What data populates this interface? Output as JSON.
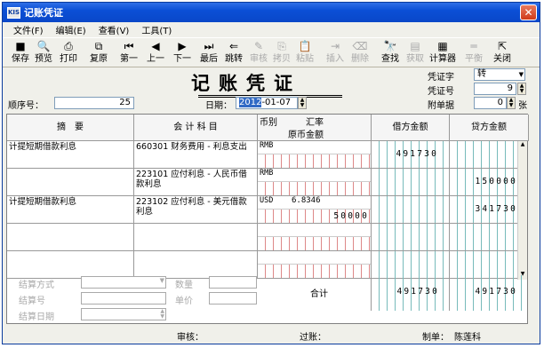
{
  "window": {
    "title": "记账凭证",
    "app_icon": "KIS"
  },
  "menu": [
    "文件(F)",
    "编辑(E)",
    "查看(V)",
    "工具(T)"
  ],
  "toolbar": [
    {
      "label": "保存",
      "icon": "save-icon",
      "glyph": "■",
      "enabled": true
    },
    {
      "label": "预览",
      "icon": "preview-icon",
      "glyph": "🔍",
      "enabled": true
    },
    {
      "label": "打印",
      "icon": "print-icon",
      "glyph": "⎙",
      "enabled": true
    },
    {
      "label": "复原",
      "icon": "restore-icon",
      "glyph": "⧉",
      "enabled": true
    },
    {
      "label": "第一",
      "icon": "first-icon",
      "glyph": "⏮",
      "enabled": true
    },
    {
      "label": "上一",
      "icon": "prev-icon",
      "glyph": "◀",
      "enabled": true
    },
    {
      "label": "下一",
      "icon": "next-icon",
      "glyph": "▶",
      "enabled": true
    },
    {
      "label": "最后",
      "icon": "last-icon",
      "glyph": "⏭",
      "enabled": true
    },
    {
      "label": "跳转",
      "icon": "jump-icon",
      "glyph": "⇐",
      "enabled": true
    },
    {
      "label": "审核",
      "icon": "audit-icon",
      "glyph": "✎",
      "enabled": false
    },
    {
      "label": "拷贝",
      "icon": "copy-icon",
      "glyph": "⎘",
      "enabled": false
    },
    {
      "label": "粘贴",
      "icon": "paste-icon",
      "glyph": "📋",
      "enabled": false
    },
    {
      "label": "插入",
      "icon": "insert-icon",
      "glyph": "⇥",
      "enabled": false
    },
    {
      "label": "删除",
      "icon": "delete-icon",
      "glyph": "⌫",
      "enabled": false
    },
    {
      "label": "查找",
      "icon": "find-icon",
      "glyph": "🔭",
      "enabled": true
    },
    {
      "label": "获取",
      "icon": "fetch-icon",
      "glyph": "▤",
      "enabled": false
    },
    {
      "label": "计算器",
      "icon": "calculator-icon",
      "glyph": "▦",
      "enabled": true
    },
    {
      "label": "平衡",
      "icon": "balance-icon",
      "glyph": "═",
      "enabled": false
    },
    {
      "label": "关闭",
      "icon": "exit-icon",
      "glyph": "⇱",
      "enabled": true
    }
  ],
  "header": {
    "title": "记账凭证",
    "voucher_word_label": "凭证字",
    "voucher_word": "转",
    "voucher_no_label": "凭证号",
    "voucher_no": "9",
    "attachments_label": "附单据",
    "attachments": "0",
    "attachments_unit": "张",
    "seq_label": "顺序号：",
    "seq": "25",
    "date_label": "日期：",
    "date_year": "2012",
    "date_rest": "-01-07"
  },
  "columns": {
    "summary": "摘　要",
    "account": "会 计 科 目",
    "currency": "币别",
    "rate": "汇率",
    "orig": "原币金额",
    "debit": "借方金额",
    "credit": "贷方金额"
  },
  "rows": [
    {
      "summary": "计提短期借款利息",
      "account": "660301 财务费用 - 利息支出",
      "currency": "RMB",
      "rate": "",
      "orig": "",
      "debit": "491730",
      "credit": ""
    },
    {
      "summary": "",
      "account": "223101 应付利息 - 人民币借款利息",
      "currency": "RMB",
      "rate": "",
      "orig": "",
      "debit": "",
      "credit": "150000"
    },
    {
      "summary": "计提短期借款利息",
      "account": "223102 应付利息 - 美元借款利息",
      "currency": "USD",
      "rate": "6.8346",
      "orig": "50000",
      "debit": "",
      "credit": "341730"
    },
    {
      "summary": "",
      "account": "",
      "currency": "",
      "rate": "",
      "orig": "",
      "debit": "",
      "credit": ""
    },
    {
      "summary": "",
      "account": "",
      "currency": "",
      "rate": "",
      "orig": "",
      "debit": "",
      "credit": ""
    }
  ],
  "footer": {
    "settle_method": "结算方式",
    "settle_no": "结算号",
    "settle_date": "结算日期",
    "qty": "数量",
    "price": "单价",
    "total_label": "合计",
    "total_debit": "491730",
    "total_credit": "491730"
  },
  "status": {
    "audit_label": "审核：",
    "audit": "",
    "post_label": "过账：",
    "post": "",
    "maker_label": "制单：",
    "maker": "陈莲科"
  }
}
